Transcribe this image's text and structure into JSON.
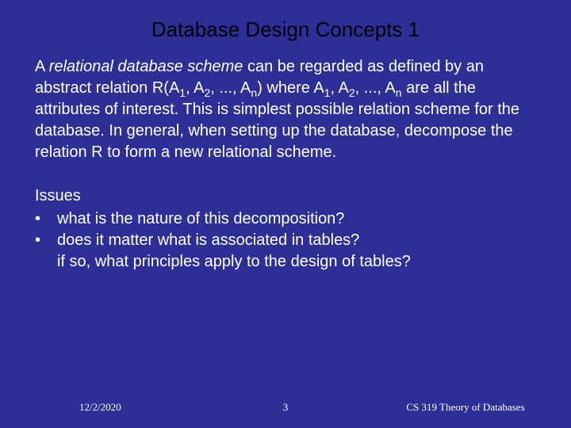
{
  "title": "Database Design Concepts 1",
  "para1_prefix": "A ",
  "para1_italic": "relational database scheme",
  "para1_seg1": " can be regarded as defined by an abstract relation R(A",
  "para1_seg2": ", A",
  "para1_seg3": ", ..., A",
  "para1_seg4": ") where A",
  "para1_seg5": ", A",
  "para1_seg6": ", ..., A",
  "para1_seg7": " are all the attributes of interest. This is simplest possible relation scheme for the database. In general, when setting up the database, decompose the relation R to form a new relational scheme.",
  "sub1": "1",
  "sub2": "2",
  "subn": "n",
  "issues_label": "Issues",
  "bullet_dot": "•",
  "bullet1": "what is the nature of this decomposition?",
  "bullet2": "does it matter what is associated in tables?",
  "bullet2_cont": "if so, what principles apply to the design of tables?",
  "footer": {
    "date": "12/2/2020",
    "page": "3",
    "course": "CS 319 Theory of Databases"
  }
}
